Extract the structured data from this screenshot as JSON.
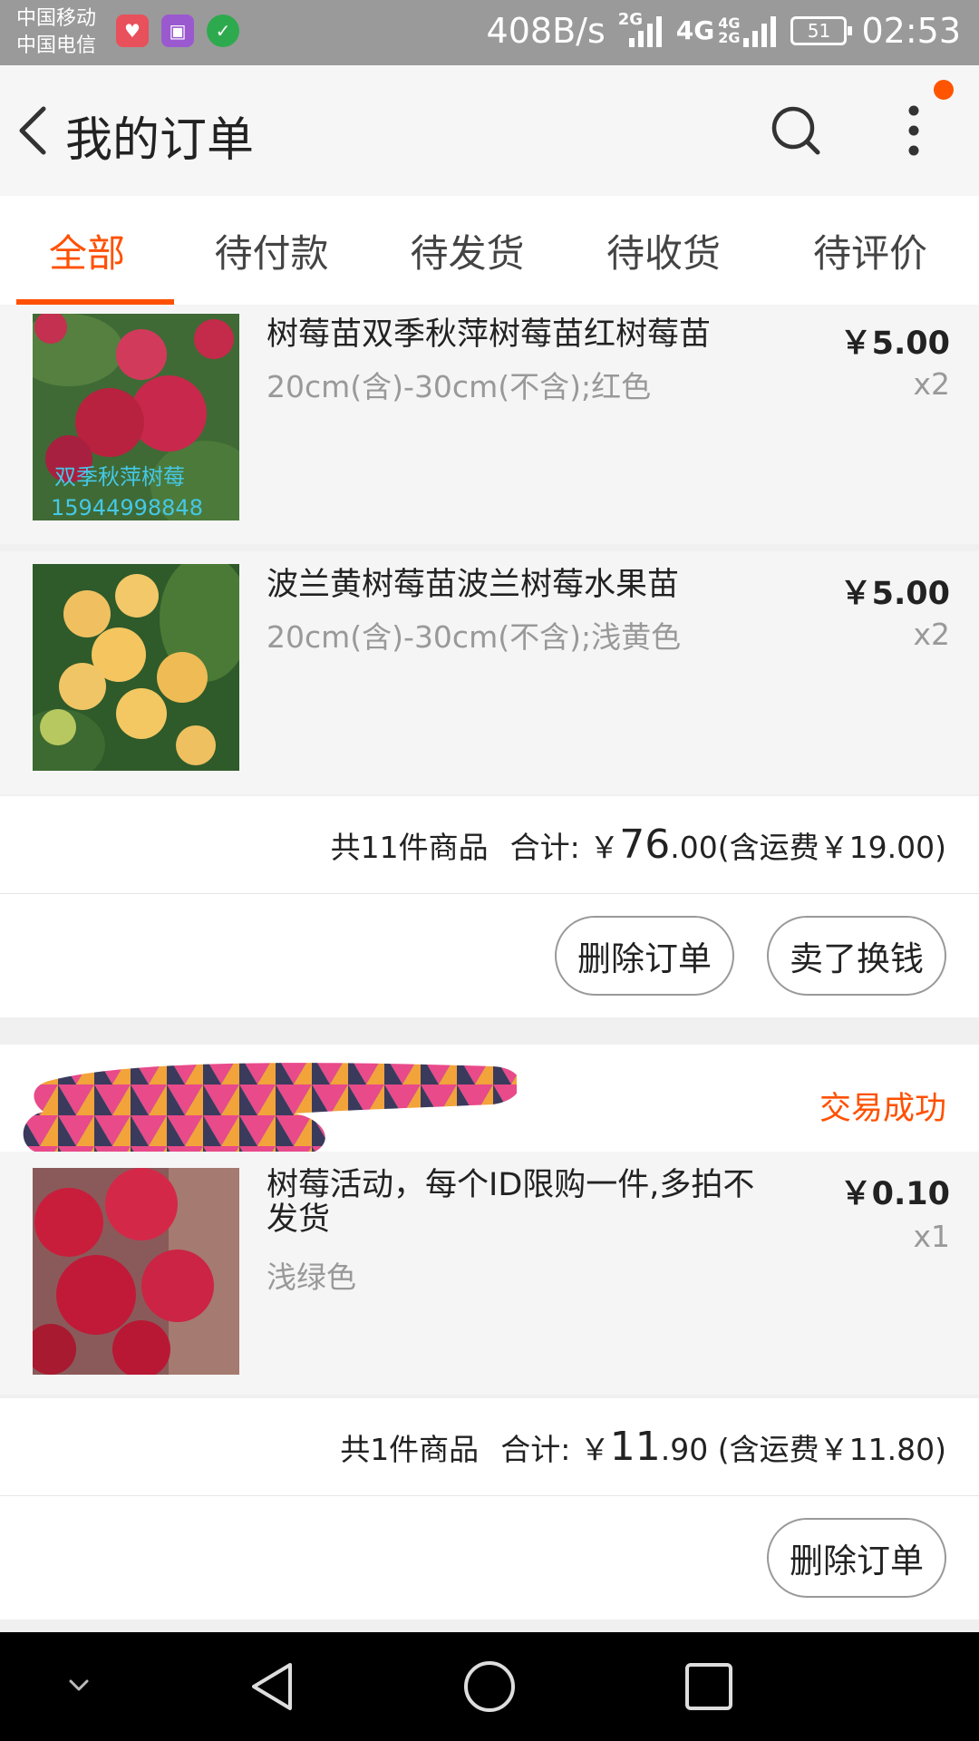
{
  "status_bar": {
    "carrier_1": "中国移动",
    "carrier_2": "中国电信",
    "net_speed": "408B/s",
    "net_type_1": "2G",
    "net_type_2": "4G",
    "net_type_3a": "4G",
    "net_type_3b": "2G",
    "battery": "51",
    "time": "02:53"
  },
  "header": {
    "title": "我的订单"
  },
  "tabs": [
    {
      "label": "全部",
      "active": true
    },
    {
      "label": "待付款"
    },
    {
      "label": "待发货"
    },
    {
      "label": "待收货"
    },
    {
      "label": "待评价"
    }
  ],
  "order1": {
    "items": [
      {
        "title": "树莓苗双季秋萍树莓苗红树莓苗",
        "spec": "20cm(含)-30cm(不含);红色",
        "price": "￥5.00",
        "qty": "x2",
        "image_watermark_1": "双季秋萍树莓",
        "image_watermark_2": "15944998848"
      },
      {
        "title": "波兰黄树莓苗波兰树莓水果苗",
        "spec": "20cm(含)-30cm(不含);浅黄色",
        "price": "￥5.00",
        "qty": "x2"
      }
    ],
    "summary": {
      "count": "共11件商品",
      "total_label": "合计: ￥",
      "total_int": "76",
      "total_dec": ".00",
      "shipping": "(含运费￥19.00)"
    },
    "actions": {
      "delete": "删除订单",
      "resell": "卖了换钱"
    }
  },
  "order2": {
    "status": "交易成功",
    "items": [
      {
        "title": "树莓活动，每个ID限购一件,多拍不发货",
        "spec": "浅绿色",
        "price": "￥0.10",
        "qty": "x1"
      }
    ],
    "summary": {
      "count": "共1件商品",
      "total_label": "合计: ￥",
      "total_int": "11",
      "total_dec": ".90",
      "shipping": " (含运费￥11.80)"
    },
    "actions": {
      "delete": "删除订单"
    }
  },
  "colors": {
    "accent": "#ff5000",
    "status_bar": "#9a9a9a",
    "nav_bar": "#000000"
  }
}
